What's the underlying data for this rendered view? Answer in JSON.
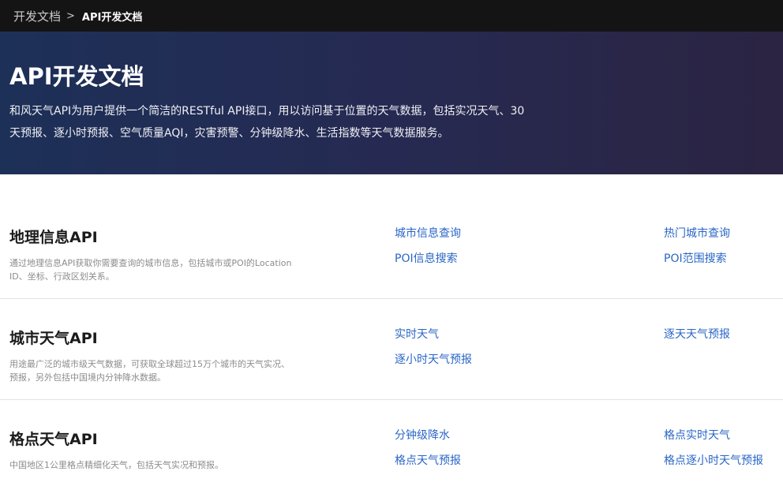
{
  "breadcrumb": {
    "root": "开发文档",
    "separator": ">",
    "current": "API开发文档"
  },
  "hero": {
    "title": "API开发文档",
    "description": "和风天气API为用户提供一个简洁的RESTful API接口，用以访问基于位置的天气数据，包括实况天气、30天预报、逐小时预报、空气质量AQI，灾害预警、分钟级降水、生活指数等天气数据服务。"
  },
  "sections": [
    {
      "title": "地理信息API",
      "description": "通过地理信息API获取你需要查询的城市信息，包括城市或POI的Location ID、坐标、行政区划关系。",
      "links": [
        "城市信息查询",
        "热门城市查询",
        "POI信息搜索",
        "POI范围搜索"
      ]
    },
    {
      "title": "城市天气API",
      "description": "用途最广泛的城市级天气数据，可获取全球超过15万个城市的天气实况、预报，另外包括中国境内分钟降水数据。",
      "links": [
        "实时天气",
        "逐天天气预报",
        "逐小时天气预报"
      ]
    },
    {
      "title": "格点天气API",
      "description": "中国地区1公里格点精细化天气，包括天气实况和预报。",
      "links": [
        "分钟级降水",
        "格点实时天气",
        "格点天气预报",
        "格点逐小时天气预报"
      ]
    }
  ],
  "colors": {
    "topbar": "#141414",
    "link": "#2a66c6",
    "hero_start": "#1d3058",
    "hero_end": "#2b2442"
  }
}
